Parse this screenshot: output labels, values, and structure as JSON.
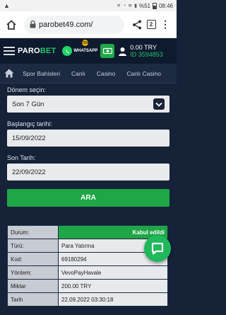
{
  "status_bar": {
    "left": "▲",
    "battery": "%51",
    "time": "08:46"
  },
  "browser": {
    "url": "parobet49.com/",
    "tab_count": "2"
  },
  "header": {
    "logo_prefix": "PARO",
    "logo_suffix": "BET",
    "whatsapp_label": "WHATSAPP",
    "whatsapp_badge": "7/24",
    "balance": "0.00 TRY",
    "account_id": "ID 3594853"
  },
  "nav": {
    "items": [
      "Spor Bahisleri",
      "Canlı",
      "Casino",
      "Canlı Casino"
    ]
  },
  "form": {
    "period_label": "Dönem seçin:",
    "period_value": "Son 7 Gün",
    "start_label": "Başlangıç tarihi:",
    "start_value": "15/09/2022",
    "end_label": "Son Tarih:",
    "end_value": "22/09/2022",
    "search_label": "ARA"
  },
  "details": {
    "rows": [
      {
        "key": "Durum:",
        "value": "Kabul edildi"
      },
      {
        "key": "Türü:",
        "value": "Para Yatırma"
      },
      {
        "key": "Kod:",
        "value": "69180294"
      },
      {
        "key": "Yöntem:",
        "value": "VevoPayHavale"
      },
      {
        "key": "Miktar",
        "value": "200.00 TRY"
      },
      {
        "key": "Tarih",
        "value": "22.09.2022 03:30:18"
      }
    ]
  },
  "colors": {
    "accent_green": "#1fa647",
    "background": "#152238"
  },
  "icons": [
    "home-icon",
    "lock-icon",
    "share-icon",
    "tabs-icon",
    "more-icon",
    "menu-icon",
    "whatsapp-icon",
    "cashier-icon",
    "user-icon",
    "chevron-down-icon",
    "chat-icon"
  ]
}
